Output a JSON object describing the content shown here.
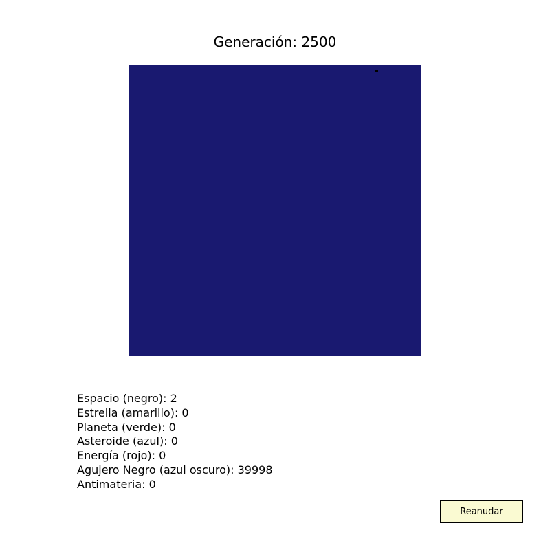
{
  "title": "Generación: 2500",
  "grid": {
    "fill_color": "#191970",
    "space_color": "#000000"
  },
  "stats": [
    {
      "text": "Espacio (negro): 2"
    },
    {
      "text": "Estrella (amarillo): 0"
    },
    {
      "text": "Planeta (verde): 0"
    },
    {
      "text": "Asteroide (azul): 0"
    },
    {
      "text": "Energía (rojo): 0"
    },
    {
      "text": "Agujero Negro (azul oscuro): 39998"
    },
    {
      "text": "Antimateria: 0"
    }
  ],
  "controls": {
    "resume_label": "Reanudar",
    "resume_color": "#fafad2"
  }
}
